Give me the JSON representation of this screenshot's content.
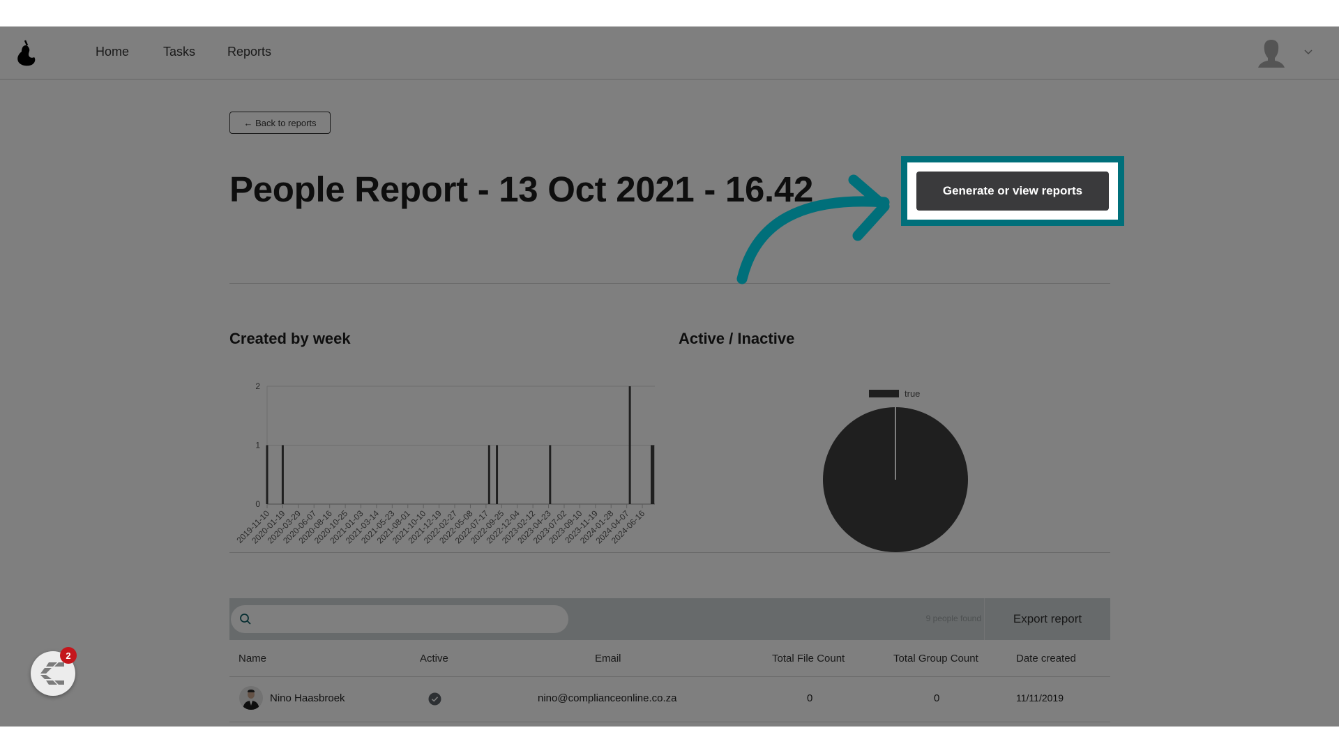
{
  "nav": {
    "logo_icon": "pear-logo-icon",
    "links": [
      {
        "label": "Home"
      },
      {
        "label": "Tasks"
      },
      {
        "label": "Reports"
      }
    ],
    "user_icon": "user-avatar-icon",
    "menu_icon": "chevron-down-icon"
  },
  "page": {
    "back_label": "← Back to reports",
    "title": "People Report - 13 Oct 2021 - 16.42",
    "generate_label": "Generate or view reports"
  },
  "charts": {
    "bar_title": "Created by week",
    "pie_title": "Active / Inactive"
  },
  "chart_data": [
    {
      "type": "bar",
      "title": "Created by week",
      "xlabel": "",
      "ylabel": "",
      "ylim": [
        0,
        2
      ],
      "yticks": [
        0,
        1,
        2
      ],
      "grid": true,
      "tick_labels": [
        "2019-11-10",
        "2020-01-19",
        "2020-03-29",
        "2020-06-07",
        "2020-08-16",
        "2020-10-25",
        "2021-01-03",
        "2021-03-14",
        "2021-05-23",
        "2021-08-01",
        "2021-10-10",
        "2021-12-19",
        "2022-02-27",
        "2022-05-08",
        "2022-07-17",
        "2022-09-25",
        "2022-12-04",
        "2023-02-12",
        "2023-04-23",
        "2023-07-02",
        "2023-09-10",
        "2023-11-19",
        "2024-01-28",
        "2024-04-07",
        "2024-06-16"
      ],
      "bars": [
        {
          "week": "2019-11-10",
          "value": 1
        },
        {
          "week": "2020-01-19",
          "value": 1
        },
        {
          "week": "2022-07-31",
          "value": 1
        },
        {
          "week": "2022-09-04",
          "value": 1
        },
        {
          "week": "2023-04-30",
          "value": 1
        },
        {
          "week": "2024-04-21",
          "value": 2
        },
        {
          "week": "2024-07-28",
          "value": 1
        },
        {
          "week": "2024-08-04",
          "value": 1
        }
      ]
    },
    {
      "type": "pie",
      "title": "Active / Inactive",
      "legend": [
        "true"
      ],
      "legend_position": "top",
      "slices": [
        {
          "label": "true",
          "value": 9
        }
      ],
      "colors": [
        "#3f3f3f"
      ]
    }
  ],
  "table": {
    "search_placeholder": "",
    "search_icon": "search-icon",
    "found_text": "9 people found",
    "export_label": "Export report",
    "columns": [
      "Name",
      "Active",
      "Email",
      "Total File Count",
      "Total Group Count",
      "Date created"
    ],
    "rows": [
      {
        "name": "Nino Haasbroek",
        "active": true,
        "email": "nino@complianceonline.co.za",
        "files": "0",
        "groups": "0",
        "created": "11/11/2019"
      }
    ]
  },
  "widget": {
    "badge": "2"
  },
  "colors": {
    "accent": "#006f7a",
    "button": "#3a3a3c",
    "badge": "#c4161c"
  }
}
